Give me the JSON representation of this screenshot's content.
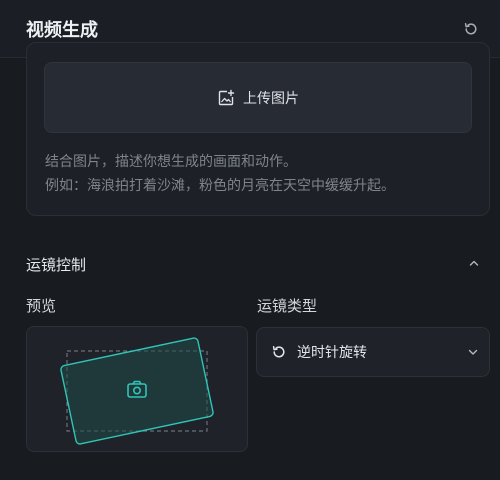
{
  "header": {
    "title": "视频生成",
    "reset_icon": "refresh-icon"
  },
  "prompt": {
    "upload_label": "上传图片",
    "upload_icon": "image-add-icon",
    "placeholder_line1": "结合图片，描述你想生成的画面和动作。",
    "placeholder_line2": "例如：海浪拍打着沙滩，粉色的月亮在天空中缓缓升起。"
  },
  "camera": {
    "section_title": "运镜控制",
    "collapse_icon": "chevron-up-icon",
    "preview_label": "预览",
    "type_label": "运镜类型",
    "selected_type": "逆时针旋转",
    "selected_type_icon": "rotate-ccw-icon",
    "dropdown_icon": "chevron-down-icon",
    "preview_icon": "camera-icon"
  },
  "colors": {
    "accent": "#2fc5b7",
    "background": "#181b20",
    "card": "#1d2026"
  }
}
